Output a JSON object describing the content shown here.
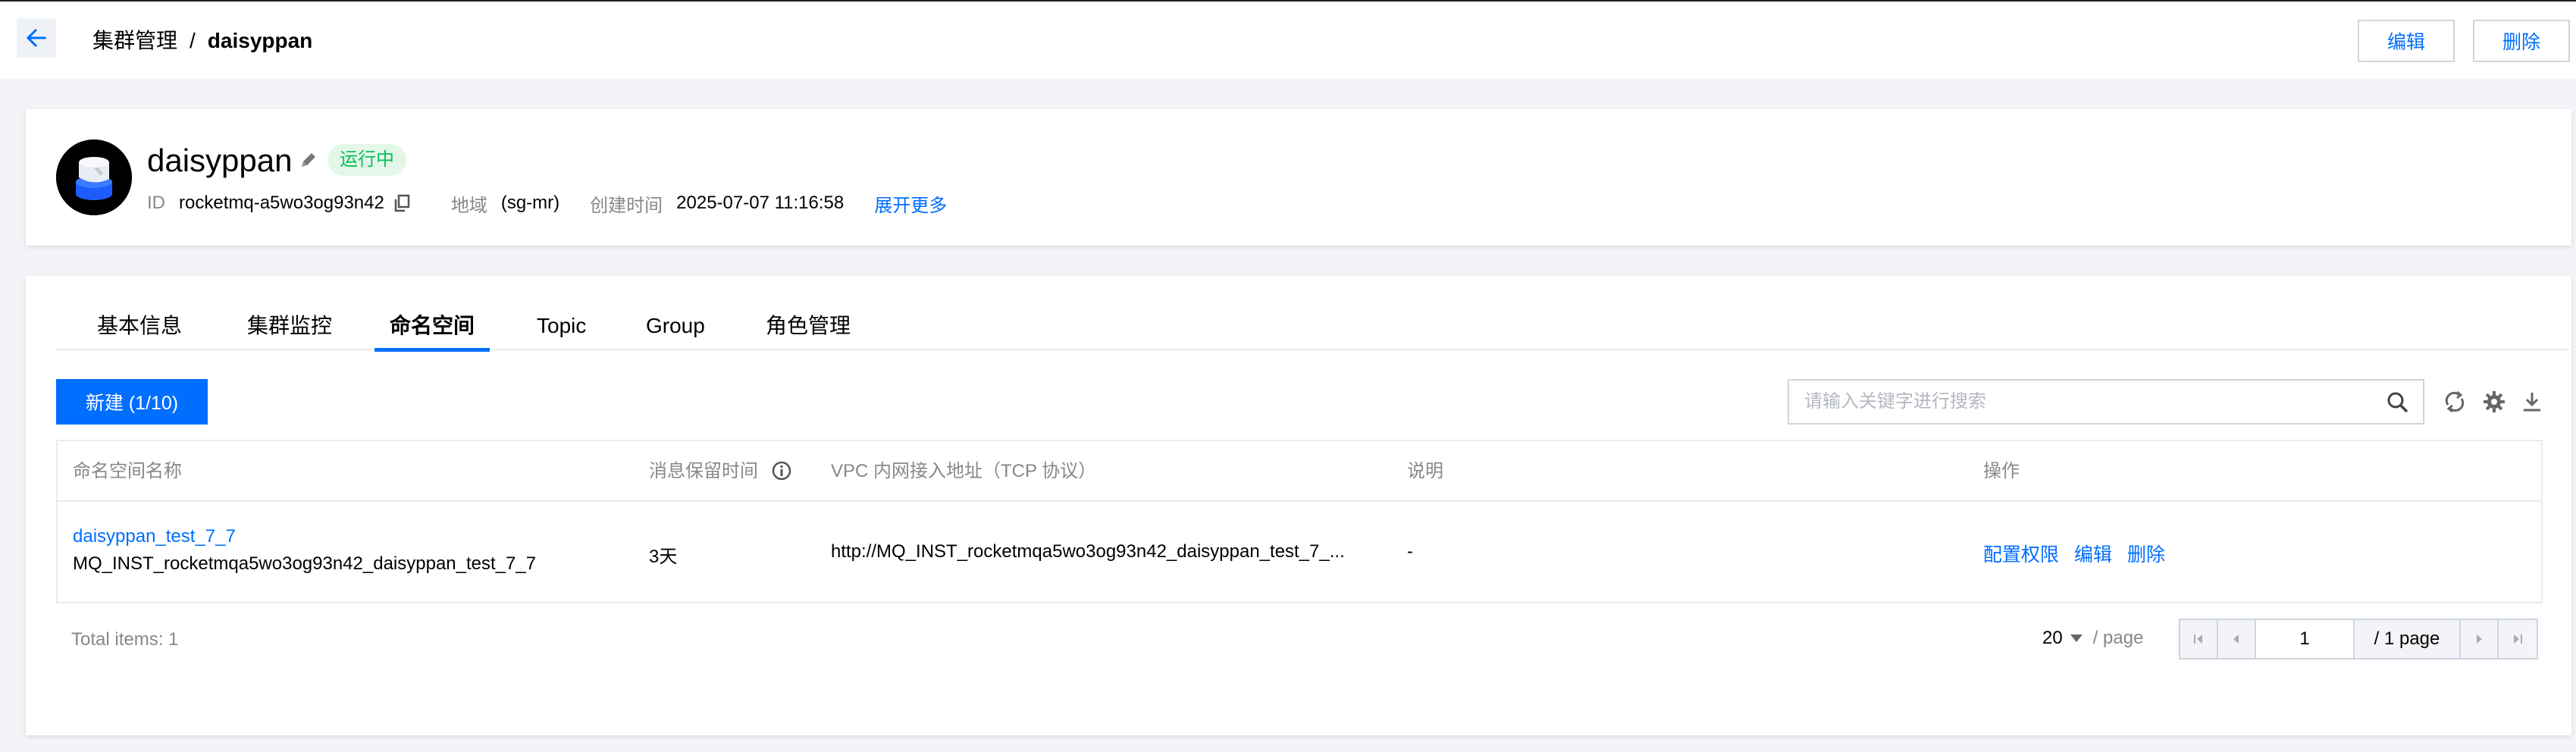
{
  "header": {
    "breadcrumb_parent": "集群管理",
    "breadcrumb_sep": "/",
    "breadcrumb_current": "daisyppan",
    "edit_label": "编辑",
    "delete_label": "删除"
  },
  "cluster": {
    "name": "daisyppan",
    "status": "运行中",
    "id_label": "ID",
    "id_value": "rocketmq-a5wo3og93n42",
    "region_label": "地域",
    "region_value": "(sg-mr)",
    "created_label": "创建时间",
    "created_value": "2025-07-07 11:16:58",
    "expand_label": "展开更多"
  },
  "tabs": [
    {
      "label": "基本信息",
      "active": false
    },
    {
      "label": "集群监控",
      "active": false
    },
    {
      "label": "命名空间",
      "active": true
    },
    {
      "label": "Topic",
      "active": false
    },
    {
      "label": "Group",
      "active": false
    },
    {
      "label": "角色管理",
      "active": false
    }
  ],
  "toolbar": {
    "new_label": "新建 (1/10)",
    "search_placeholder": "请输入关键字进行搜索"
  },
  "table": {
    "columns": [
      "命名空间名称",
      "消息保留时间",
      "VPC 内网接入地址（TCP 协议）",
      "说明",
      "操作"
    ],
    "rows": [
      {
        "name": "daisyppan_test_7_7",
        "full_name": "MQ_INST_rocketmqa5wo3og93n42_daisyppan_test_7_7",
        "retention": "3天",
        "vpc": "http://MQ_INST_rocketmqa5wo3og93n42_daisyppan_test_7_...",
        "desc": "-",
        "ops": [
          "配置权限",
          "编辑",
          "删除"
        ]
      }
    ]
  },
  "pagination": {
    "total": "Total items:  1",
    "page_size": "20",
    "page_size_unit": "/ page",
    "current_page": "1",
    "total_pages": "/ 1 page"
  },
  "colors": {
    "primary": "#006eff",
    "status_bg": "#e3f7e9",
    "status_text": "#0abf5b"
  }
}
